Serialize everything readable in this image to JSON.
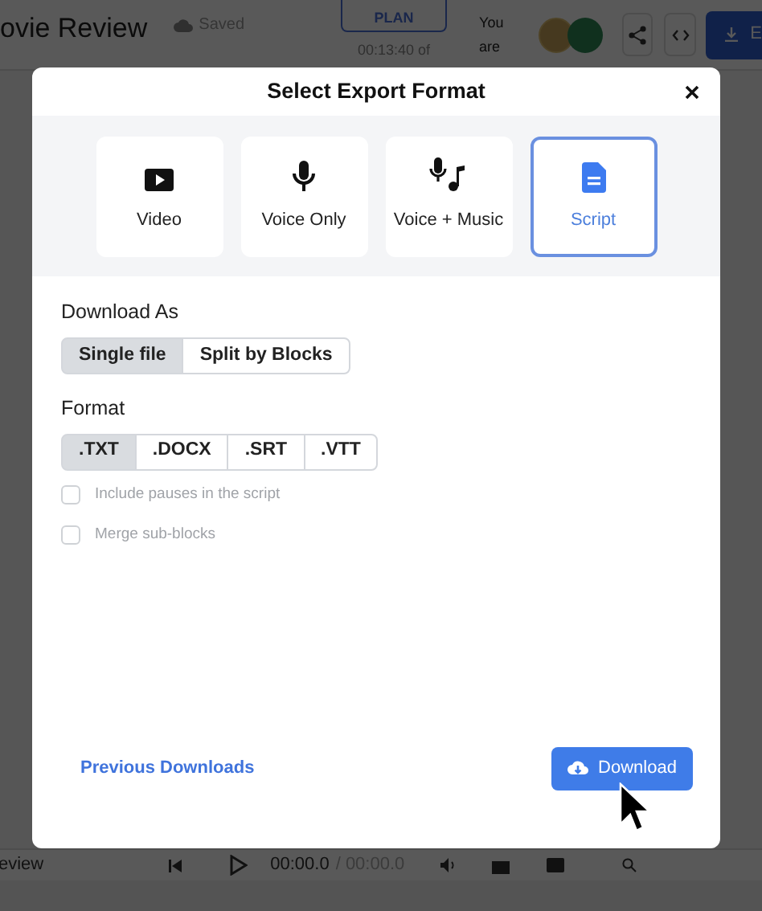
{
  "background": {
    "project_title": "ovie Review",
    "save_status": "Saved",
    "plan_button": "PLAN",
    "duration": "00:13:40 of",
    "presence_label": [
      "You",
      "are"
    ],
    "export_button": "E",
    "player": {
      "title": "eview",
      "current_time": "00:00.0",
      "total_time": "/ 00:00.0"
    }
  },
  "dialog": {
    "title": "Select Export Format",
    "formats": [
      {
        "kind": "video",
        "label": "Video",
        "selected": false
      },
      {
        "kind": "voice",
        "label": "Voice Only",
        "selected": false
      },
      {
        "kind": "voice_music",
        "label": "Voice + Music",
        "selected": false
      },
      {
        "kind": "script",
        "label": "Script",
        "selected": true
      }
    ],
    "download_as": {
      "label": "Download As",
      "options": [
        {
          "label": "Single file",
          "selected": true
        },
        {
          "label": "Split by Blocks",
          "selected": false
        }
      ]
    },
    "format": {
      "label": "Format",
      "options": [
        {
          "label": ".TXT",
          "selected": true
        },
        {
          "label": ".DOCX",
          "selected": false
        },
        {
          "label": ".SRT",
          "selected": false
        },
        {
          "label": ".VTT",
          "selected": false
        }
      ]
    },
    "checkboxes": [
      {
        "label": "Include pauses in the script",
        "checked": false,
        "disabled": true
      },
      {
        "label": "Merge sub-blocks",
        "checked": false,
        "disabled": true
      }
    ],
    "previous_downloads": "Previous Downloads",
    "download_button": "Download"
  }
}
